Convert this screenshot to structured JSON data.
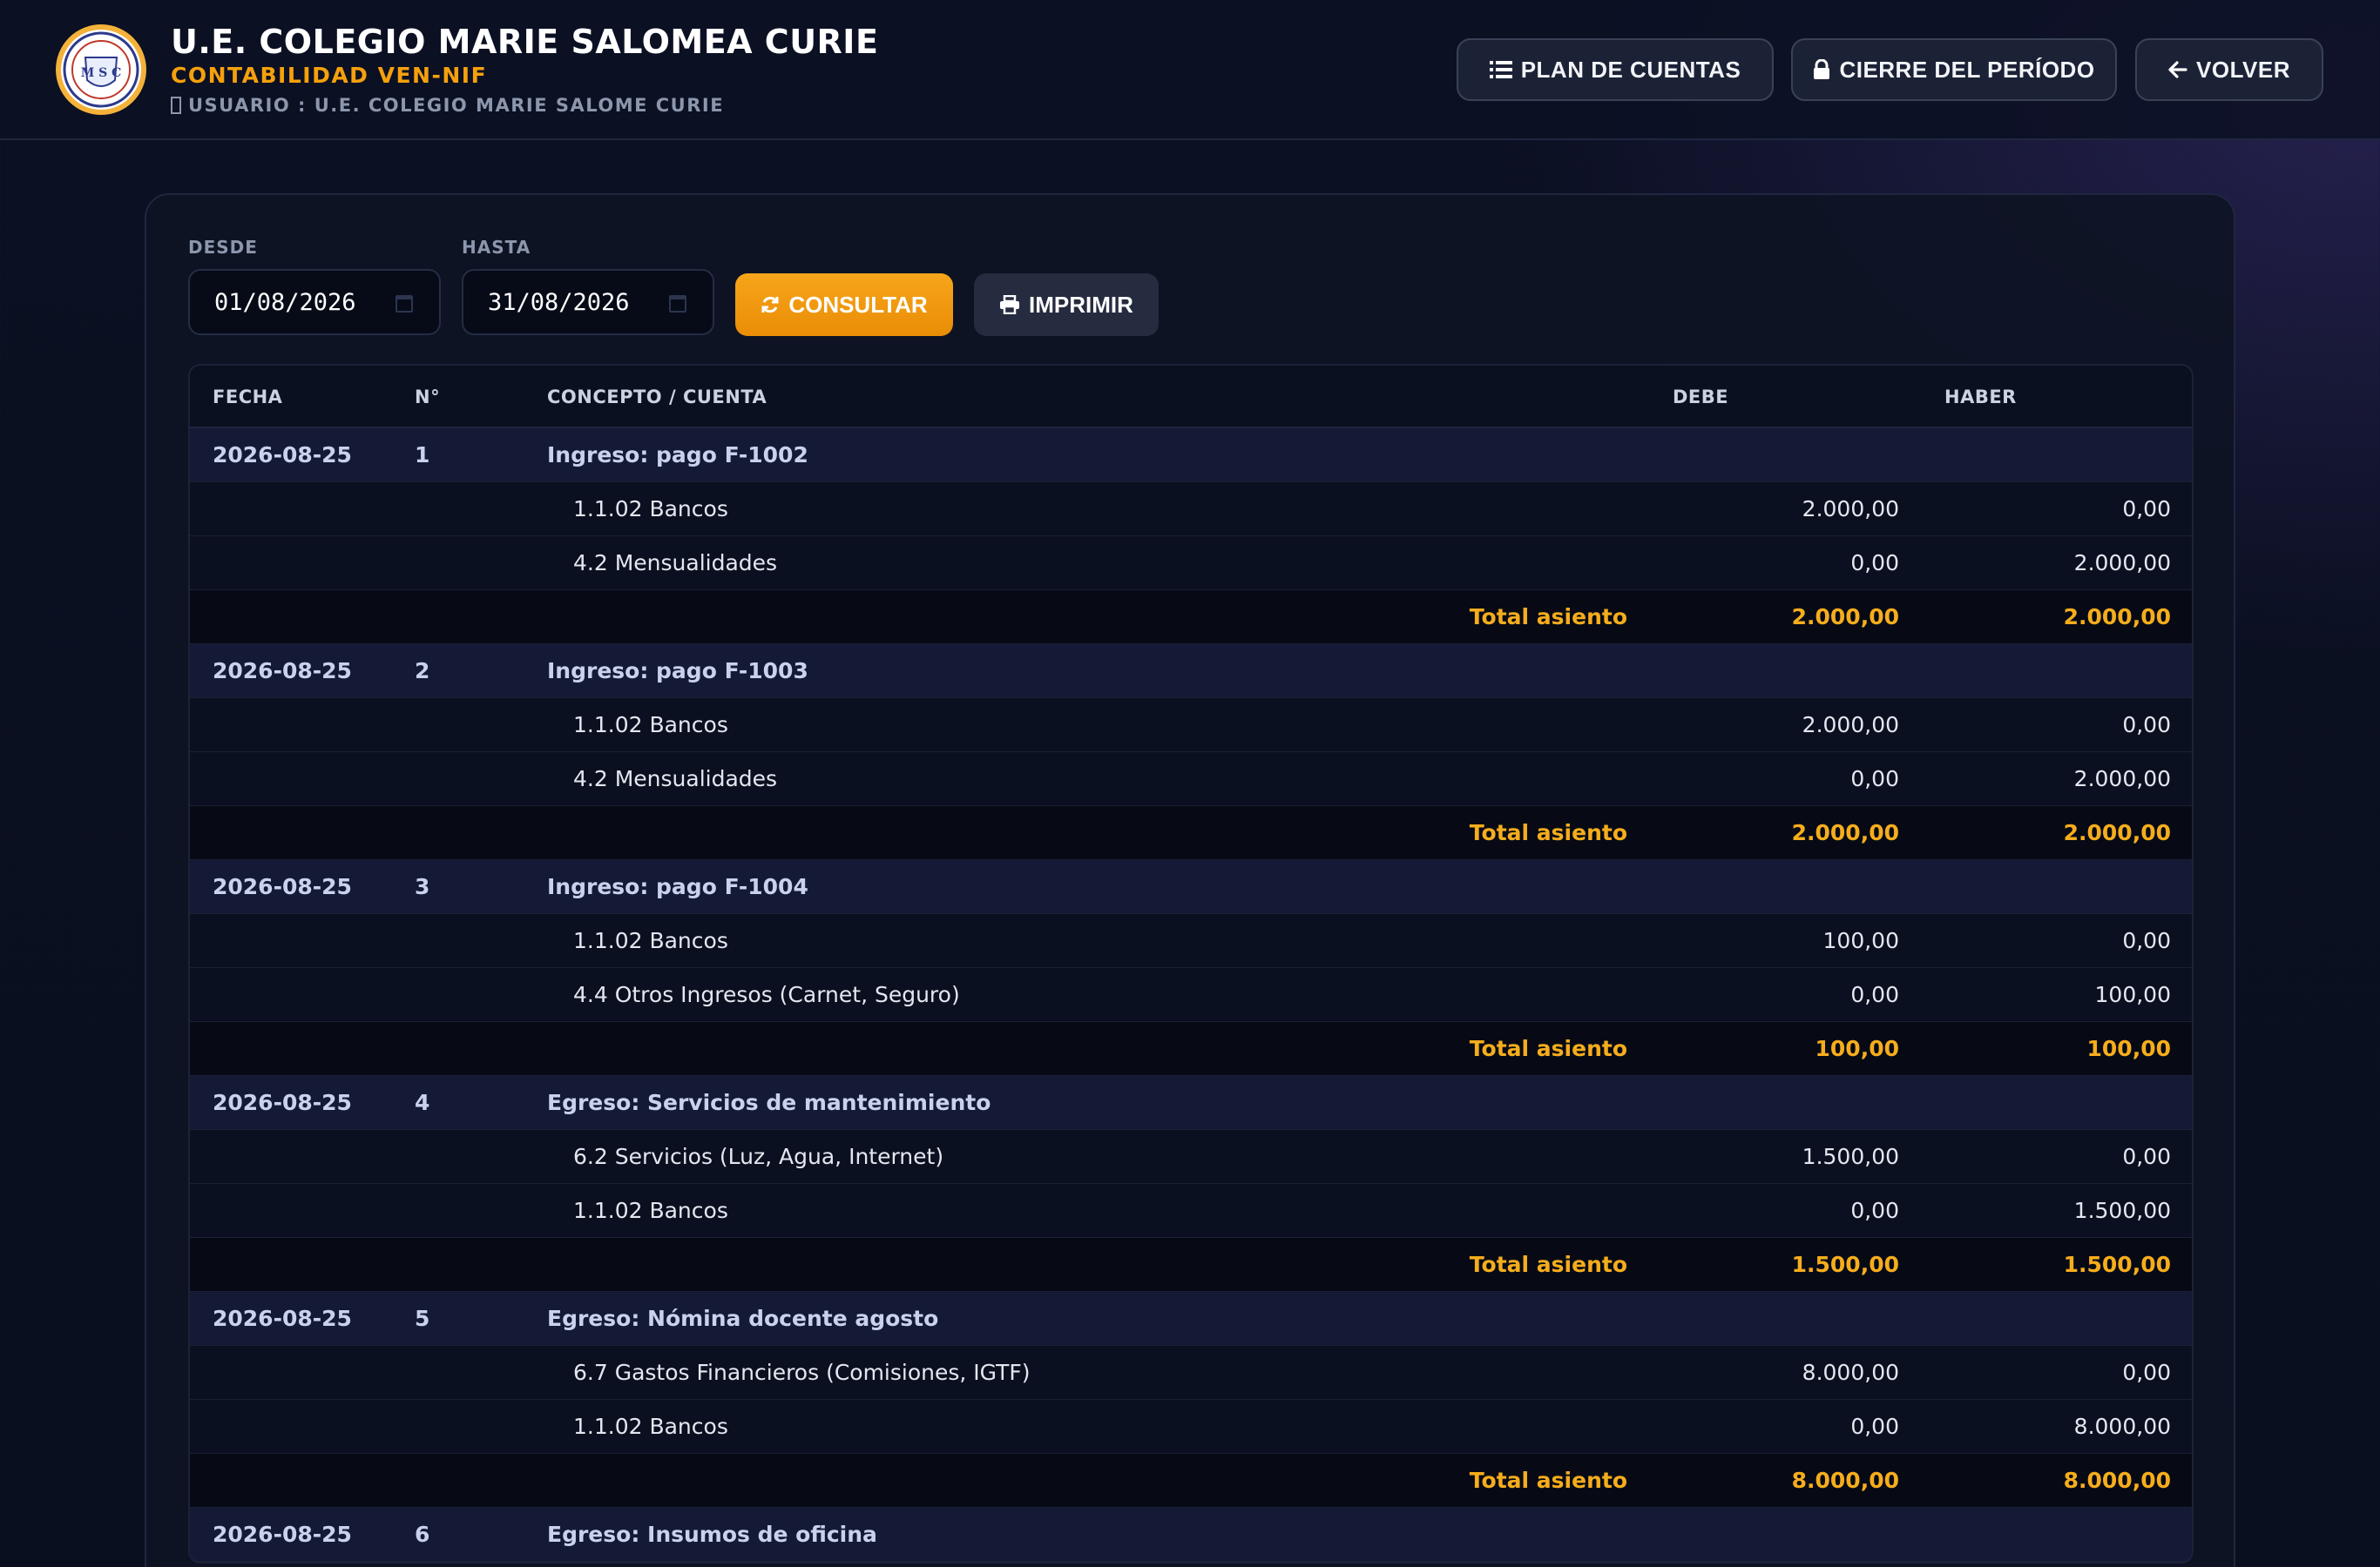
{
  "header": {
    "title": "U.E. COLEGIO MARIE SALOMEA CURIE",
    "subtitle": "CONTABILIDAD VEN-NIF",
    "user": "USUARIO : U.E. COLEGIO MARIE SALOME CURIE",
    "logo_text": "M S C",
    "buttons": {
      "plan": "PLAN DE CUENTAS",
      "cierre": "CIERRE DEL PERÍODO",
      "volver": "VOLVER"
    }
  },
  "filters": {
    "desde_label": "DESDE",
    "desde_value": "01/08/2026",
    "hasta_label": "HASTA",
    "hasta_value": "31/08/2026",
    "consultar_label": "CONSULTAR",
    "imprimir_label": "IMPRIMIR"
  },
  "table": {
    "columns": {
      "fecha": "FECHA",
      "num": "N°",
      "concepto": "CONCEPTO / CUENTA",
      "debe": "DEBE",
      "haber": "HABER"
    },
    "total_label": "Total asiento",
    "entries": [
      {
        "fecha": "2026-08-25",
        "num": "1",
        "concepto": "Ingreso: pago F-1002",
        "lines": [
          {
            "cuenta": "1.1.02 Bancos",
            "debe": "2.000,00",
            "haber": "0,00"
          },
          {
            "cuenta": "4.2 Mensualidades",
            "debe": "0,00",
            "haber": "2.000,00"
          }
        ],
        "total_debe": "2.000,00",
        "total_haber": "2.000,00"
      },
      {
        "fecha": "2026-08-25",
        "num": "2",
        "concepto": "Ingreso: pago F-1003",
        "lines": [
          {
            "cuenta": "1.1.02 Bancos",
            "debe": "2.000,00",
            "haber": "0,00"
          },
          {
            "cuenta": "4.2 Mensualidades",
            "debe": "0,00",
            "haber": "2.000,00"
          }
        ],
        "total_debe": "2.000,00",
        "total_haber": "2.000,00"
      },
      {
        "fecha": "2026-08-25",
        "num": "3",
        "concepto": "Ingreso: pago F-1004",
        "lines": [
          {
            "cuenta": "1.1.02 Bancos",
            "debe": "100,00",
            "haber": "0,00"
          },
          {
            "cuenta": "4.4 Otros Ingresos (Carnet, Seguro)",
            "debe": "0,00",
            "haber": "100,00"
          }
        ],
        "total_debe": "100,00",
        "total_haber": "100,00"
      },
      {
        "fecha": "2026-08-25",
        "num": "4",
        "concepto": "Egreso: Servicios de mantenimiento",
        "lines": [
          {
            "cuenta": "6.2 Servicios (Luz, Agua, Internet)",
            "debe": "1.500,00",
            "haber": "0,00"
          },
          {
            "cuenta": "1.1.02 Bancos",
            "debe": "0,00",
            "haber": "1.500,00"
          }
        ],
        "total_debe": "1.500,00",
        "total_haber": "1.500,00"
      },
      {
        "fecha": "2026-08-25",
        "num": "5",
        "concepto": "Egreso: Nómina docente agosto",
        "lines": [
          {
            "cuenta": "6.7 Gastos Financieros (Comisiones, IGTF)",
            "debe": "8.000,00",
            "haber": "0,00"
          },
          {
            "cuenta": "1.1.02 Bancos",
            "debe": "0,00",
            "haber": "8.000,00"
          }
        ],
        "total_debe": "8.000,00",
        "total_haber": "8.000,00"
      },
      {
        "fecha": "2026-08-25",
        "num": "6",
        "concepto": "Egreso: Insumos de oficina",
        "lines": []
      }
    ]
  },
  "colors": {
    "accent": "#f5a00c",
    "entry_row": "#141a36",
    "total_text": "#f6ad1c"
  },
  "icons": {
    "plan": "list-icon",
    "cierre": "lock-icon",
    "volver": "arrow-left-icon",
    "consultar": "refresh-icon",
    "imprimir": "printer-icon",
    "user": "user-icon",
    "date": "calendar-icon"
  }
}
